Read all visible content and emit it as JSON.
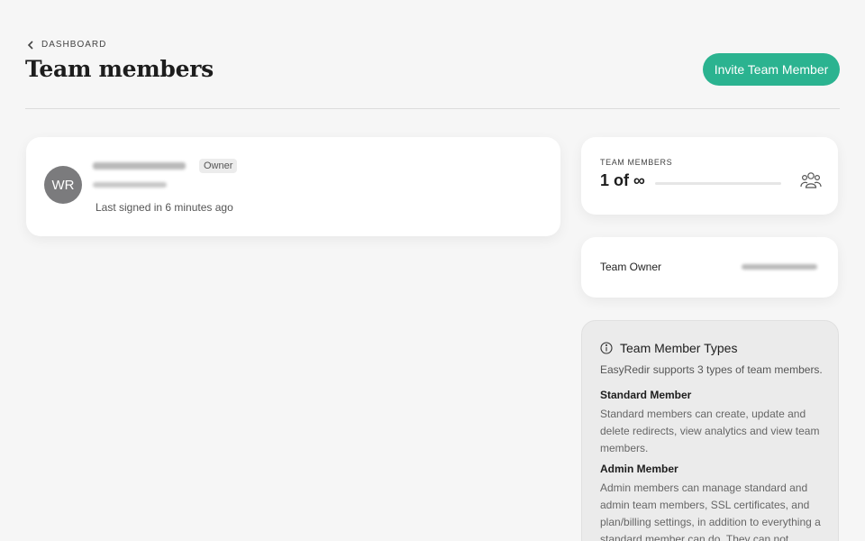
{
  "header": {
    "back_label": "DASHBOARD",
    "title": "Team members",
    "invite_label": "Invite Team Member"
  },
  "member": {
    "initials": "WR",
    "role_badge": "Owner",
    "last_signed": "Last signed in 6 minutes ago"
  },
  "stats": {
    "label": "TEAM MEMBERS",
    "value": "1 of ∞"
  },
  "owner": {
    "label": "Team Owner"
  },
  "types": {
    "title": "Team Member Types",
    "intro": "EasyRedir supports 3 types of team members.",
    "standard_title": "Standard Member",
    "standard_desc": "Standard members can create, update and delete redirects, view analytics and view team members.",
    "admin_title": "Admin Member",
    "admin_desc": "Admin members can manage standard and admin team members, SSL certificates, and plan/billing settings, in addition to everything a standard member can do. They can not change"
  },
  "colors": {
    "accent": "#2bb390",
    "avatar": "#7b7b7d",
    "background": "#f6f6f6"
  },
  "icons": [
    "chevron-left-icon",
    "people-icon",
    "info-icon"
  ]
}
